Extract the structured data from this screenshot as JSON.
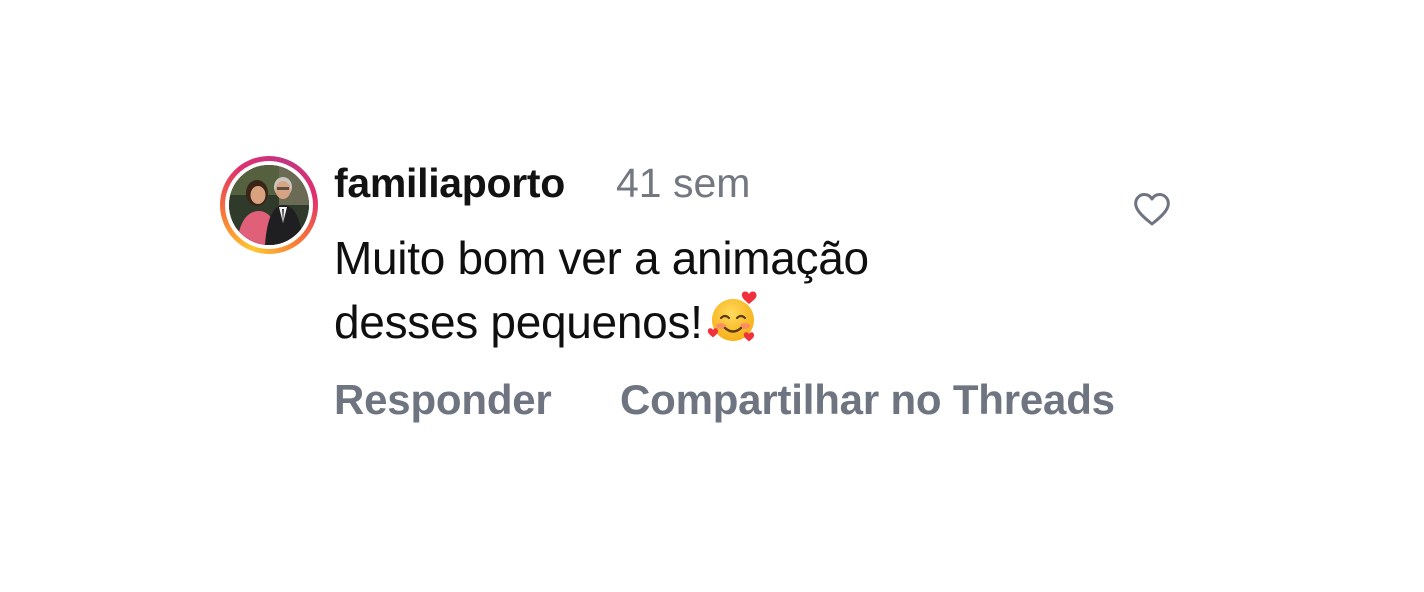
{
  "comment": {
    "username": "familiaporto",
    "timestamp": "41 sem",
    "text_lines": [
      "Muito bom ver a animação",
      "desses pequenos!"
    ],
    "emoji": "smiling-face-with-hearts",
    "actions": {
      "reply_label": "Responder",
      "share_label": "Compartilhar no Threads"
    },
    "like_icon": "heart-outline-icon"
  },
  "colors": {
    "text": "#0f0f0f",
    "secondary": "#6e7480",
    "ring_gradient": [
      "#fdc830",
      "#f77737",
      "#e1306c",
      "#c13584"
    ]
  }
}
